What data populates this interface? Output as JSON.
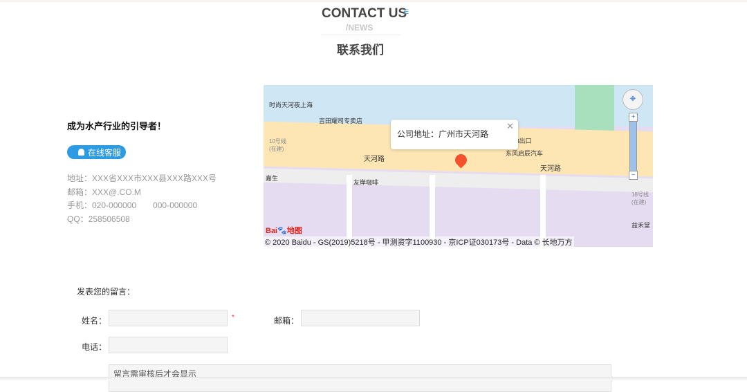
{
  "header": {
    "title_en": "CONTACT US",
    "title_sub": "/NEWS",
    "title_cn": "联系我们",
    "menu_icon": "list-icon"
  },
  "company": {
    "slogan": "成为水产行业的引导者！",
    "online_service": "在线客服",
    "address": "地址：XXX省XXX市XXX县XXX路XXX号",
    "email": "邮箱：XXX@.CO.M",
    "phone": "手机：020-000000　　000-000000",
    "qq": "QQ：258506508"
  },
  "map": {
    "popup_text": "公司地址：广州市天河路",
    "road_label": "天河路",
    "pois": [
      "时尚天河夜上海",
      "吉田耀司专卖店",
      "D3出口",
      "东风启辰汽车",
      "友岸咖啡",
      "嘉生",
      "益禾堂",
      "10号线(在建)",
      "18号线(在建)"
    ],
    "logo": "Bai地图",
    "copyright": "© 2020 Baidu - GS(2019)5218号 - 甲测资字1100930 - 京ICP证030173号 - Data © 长地万方"
  },
  "form": {
    "title": "发表您的留言：",
    "name_label": "姓名：",
    "required_mark": "*",
    "email_label": "邮箱：",
    "phone_label": "电话：",
    "message_placeholder": "留言需审核后才会显示"
  }
}
